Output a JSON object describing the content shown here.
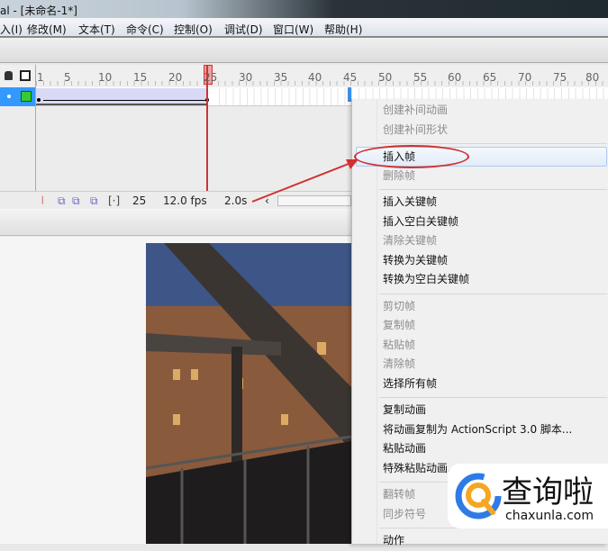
{
  "window": {
    "title": "al - [未命名-1*]"
  },
  "menubar": [
    "入(I)",
    "修改(M)",
    "文本(T)",
    "命令(C)",
    "控制(O)",
    "调试(D)",
    "窗口(W)",
    "帮助(H)"
  ],
  "timeline": {
    "frame_numbers": [
      "1",
      "5",
      "10",
      "15",
      "20",
      "25",
      "30",
      "35",
      "40",
      "45",
      "50",
      "55",
      "60",
      "65",
      "70",
      "75",
      "80"
    ],
    "current_frame": "25",
    "fps": "12.0 fps",
    "elapsed": "2.0s"
  },
  "context_menu": [
    {
      "label": "创建补间动画",
      "disabled": true
    },
    {
      "label": "创建补间形状",
      "disabled": true
    },
    {
      "sep": true
    },
    {
      "label": "插入帧",
      "highlighted": true
    },
    {
      "label": "删除帧",
      "disabled": true
    },
    {
      "sep": true
    },
    {
      "label": "插入关键帧"
    },
    {
      "label": "插入空白关键帧"
    },
    {
      "label": "清除关键帧",
      "disabled": true
    },
    {
      "label": "转换为关键帧"
    },
    {
      "label": "转换为空白关键帧"
    },
    {
      "sep": true
    },
    {
      "label": "剪切帧",
      "disabled": true
    },
    {
      "label": "复制帧",
      "disabled": true
    },
    {
      "label": "粘贴帧",
      "disabled": true
    },
    {
      "label": "清除帧",
      "disabled": true
    },
    {
      "label": "选择所有帧"
    },
    {
      "sep": true
    },
    {
      "label": "复制动画"
    },
    {
      "label": "将动画复制为 ActionScript 3.0 脚本..."
    },
    {
      "label": "粘贴动画"
    },
    {
      "label": "特殊粘贴动画..."
    },
    {
      "sep": true
    },
    {
      "label": "翻转帧",
      "disabled": true
    },
    {
      "label": "同步符号",
      "disabled": true
    },
    {
      "sep": true
    },
    {
      "label": "动作"
    }
  ],
  "watermark": {
    "brand": "查询啦",
    "url": "chaxunla.com"
  },
  "colors": {
    "highlight_ellipse": "#d03030",
    "playhead": "#cc3333"
  }
}
